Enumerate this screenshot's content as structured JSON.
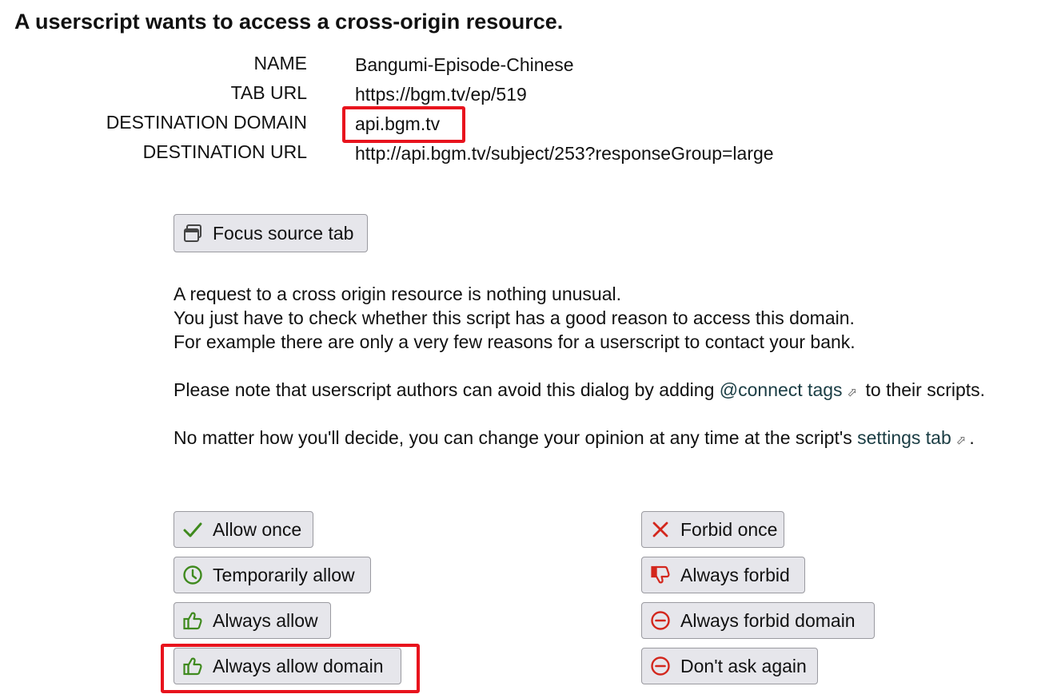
{
  "title": "A userscript wants to access a cross-origin resource.",
  "info": [
    {
      "label": "NAME",
      "value": "Bangumi-Episode-Chinese"
    },
    {
      "label": "TAB URL",
      "value": "https://bgm.tv/ep/519"
    },
    {
      "label": "DESTINATION DOMAIN",
      "value": "api.bgm.tv"
    },
    {
      "label": "DESTINATION URL",
      "value": "http://api.bgm.tv/subject/253?responseGroup=large"
    }
  ],
  "focus_button": {
    "label": "Focus source tab",
    "icon": "window-icon"
  },
  "description": {
    "line1": "A request to a cross origin resource is nothing unusual.",
    "line2": "You just have to check whether this script has a good reason to access this domain.",
    "line3": "For example there are only a very few reasons for a userscript to contact your bank.",
    "note_prefix": "Please note that userscript authors can avoid this dialog by adding ",
    "note_link": "@connect tags",
    "note_suffix": " to their scripts.",
    "change_prefix": "No matter how you'll decide, you can change your opinion at any time at the script's ",
    "change_link": "settings tab",
    "change_suffix": ".",
    "external_link_glyph": "⬀"
  },
  "allow_buttons": [
    {
      "label": "Allow once",
      "icon": "check-icon"
    },
    {
      "label": "Temporarily allow",
      "icon": "clock-icon"
    },
    {
      "label": "Always allow",
      "icon": "thumbs-up-icon"
    },
    {
      "label": "Always allow domain",
      "icon": "thumbs-up-icon"
    }
  ],
  "forbid_buttons": [
    {
      "label": "Forbid once",
      "icon": "x-icon"
    },
    {
      "label": "Always forbid",
      "icon": "thumbs-down-icon"
    },
    {
      "label": "Always forbid domain",
      "icon": "minus-circle-icon"
    },
    {
      "label": "Don't ask again",
      "icon": "minus-circle-icon"
    }
  ],
  "colors": {
    "allow_green": "#3f8a1e",
    "forbid_red": "#d3271d",
    "highlight_red": "#e8131d",
    "button_bg": "#e6e6eb"
  }
}
